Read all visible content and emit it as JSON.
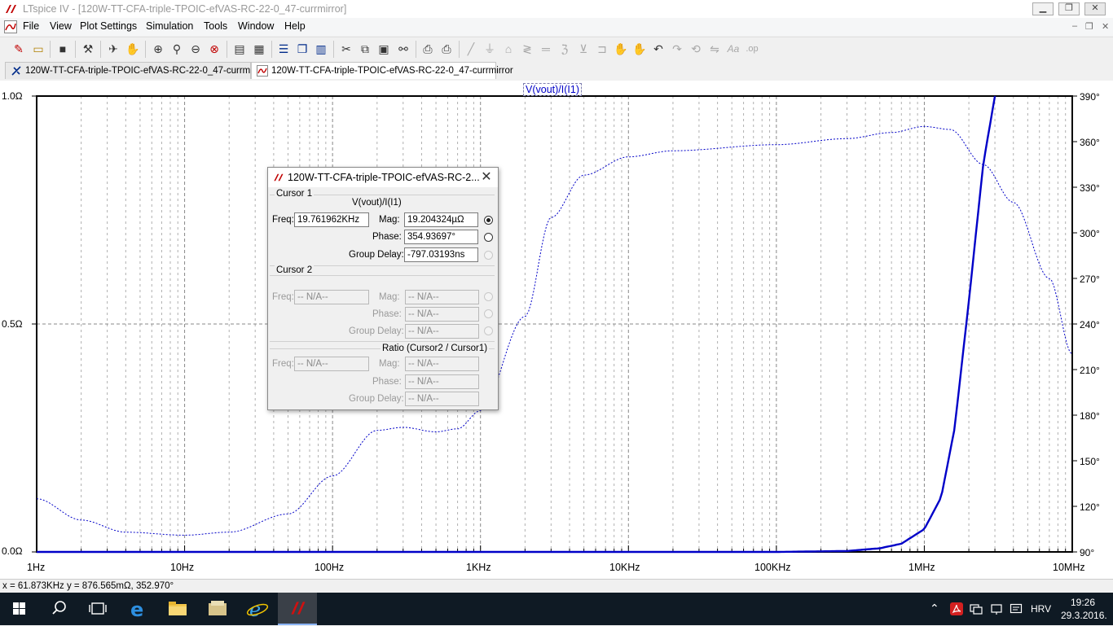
{
  "window": {
    "title": "LTspice IV - [120W-TT-CFA-triple-TPOIC-efVAS-RC-22-0_47-currmirror]",
    "controls": {
      "minimize": "▁",
      "restore": "❐",
      "close": "✕"
    }
  },
  "menu": {
    "items": [
      {
        "label": "File"
      },
      {
        "label": "View"
      },
      {
        "label": "Plot Settings"
      },
      {
        "label": "Simulation"
      },
      {
        "label": "Tools"
      },
      {
        "label": "Window"
      },
      {
        "label": "Help"
      }
    ],
    "mdi": {
      "minimize": "–",
      "restore": "❐",
      "close": "✕"
    }
  },
  "toolbar": {
    "icons": [
      "new-schematic-icon",
      "open-icon",
      "save-icon",
      "control-panel-icon",
      "run-icon",
      "halt-icon",
      "zoom-in-icon",
      "zoom-pan-icon",
      "zoom-out-icon",
      "zoom-full-icon",
      "autorange-icon",
      "tile-horizontal-icon",
      "cascade-icon",
      "tile-vertical-icon",
      "cut-icon",
      "copy-icon",
      "paste-icon",
      "find-icon",
      "print-preview-icon",
      "print-icon",
      "wire-icon",
      "ground-icon",
      "label-net-icon",
      "resistor-icon",
      "capacitor-icon",
      "inductor-icon",
      "diode-icon",
      "component-icon",
      "move-icon",
      "drag-icon",
      "undo-icon",
      "redo-icon",
      "rotate-icon",
      "mirror-icon",
      "text-icon",
      "spice-directive-icon"
    ]
  },
  "tabs": [
    {
      "label": "120W-TT-CFA-triple-TPOIC-efVAS-RC-22-0_47-currmirror",
      "icon": "schematic-icon",
      "active": false
    },
    {
      "label": "120W-TT-CFA-triple-TPOIC-efVAS-RC-22-0_47-currmirror",
      "icon": "waveform-icon",
      "active": true
    }
  ],
  "plot": {
    "trace_label": "V(vout)/I(I1)",
    "trace_color": "#0000c8",
    "y_left_ticks": [
      "1.0Ω",
      "0.5Ω",
      "0.0Ω"
    ],
    "y_right_ticks": [
      "390°",
      "360°",
      "330°",
      "300°",
      "270°",
      "240°",
      "210°",
      "180°",
      "150°",
      "120°",
      "90°"
    ],
    "x_ticks": [
      "1Hz",
      "10Hz",
      "100Hz",
      "1KHz",
      "10KHz",
      "100KHz",
      "1MHz",
      "10MHz"
    ]
  },
  "chart_data": {
    "type": "line",
    "title": "V(vout)/I(I1)",
    "xlabel": "",
    "ylabel": "",
    "x_scale": "log",
    "xlim": [
      1,
      10000000
    ],
    "ylim_left": [
      0,
      1
    ],
    "ylim_right": [
      90,
      390
    ],
    "grid": true,
    "series": [
      {
        "name": "Mag",
        "axis": "left",
        "style": "solid",
        "x": [
          1,
          10,
          1000,
          10000,
          100000,
          300000,
          500000,
          700000,
          1000000,
          1300000,
          1600000,
          2000000,
          2500000,
          3000000
        ],
        "y": [
          0.0,
          0.0,
          0.0,
          0.0,
          0.0,
          0.002,
          0.008,
          0.018,
          0.05,
          0.12,
          0.27,
          0.55,
          0.85,
          1.0
        ]
      },
      {
        "name": "Phase",
        "axis": "right",
        "style": "dashed",
        "x": [
          1,
          2,
          4,
          10,
          20,
          50,
          100,
          200,
          300,
          500,
          700,
          1000,
          2000,
          3000,
          5000,
          10000,
          20000,
          100000,
          300000,
          600000,
          1000000,
          1500000,
          2500000,
          4000000,
          7000000,
          10000000
        ],
        "y": [
          125,
          111,
          103,
          101,
          103,
          115,
          140,
          170,
          172,
          169,
          171,
          183,
          245,
          310,
          338,
          350,
          354,
          358,
          362,
          366,
          370,
          368,
          345,
          320,
          270,
          220
        ]
      }
    ]
  },
  "status": {
    "text": "x = 61.873KHz   y = 876.565mΩ, 352.970°"
  },
  "dialog": {
    "title": "120W-TT-CFA-triple-TPOIC-efVAS-RC-2...",
    "close": "✕",
    "cursor1": {
      "heading": "Cursor 1",
      "expr": "V(vout)/I(I1)",
      "freq_label": "Freq:",
      "freq": "19.761962KHz",
      "mag_label": "Mag:",
      "mag": "19.204324µΩ",
      "phase_label": "Phase:",
      "phase": "354.93697°",
      "gd_label": "Group Delay:",
      "gd": "-797.03193ns"
    },
    "cursor2": {
      "heading": "Cursor 2",
      "freq_label": "Freq:",
      "freq": "-- N/A--",
      "mag_label": "Mag:",
      "mag": "-- N/A--",
      "phase_label": "Phase:",
      "phase": "-- N/A--",
      "gd_label": "Group Delay:",
      "gd": "-- N/A--"
    },
    "ratio": {
      "heading": "Ratio (Cursor2 / Cursor1)",
      "freq_label": "Freq:",
      "freq": "-- N/A--",
      "mag_label": "Mag:",
      "mag": "-- N/A--",
      "phase_label": "Phase:",
      "phase": "-- N/A--",
      "gd_label": "Group Delay:",
      "gd": "-- N/A--"
    }
  },
  "taskbar": {
    "lang": "HRV",
    "time": "19:26",
    "date": "29.3.2016."
  }
}
